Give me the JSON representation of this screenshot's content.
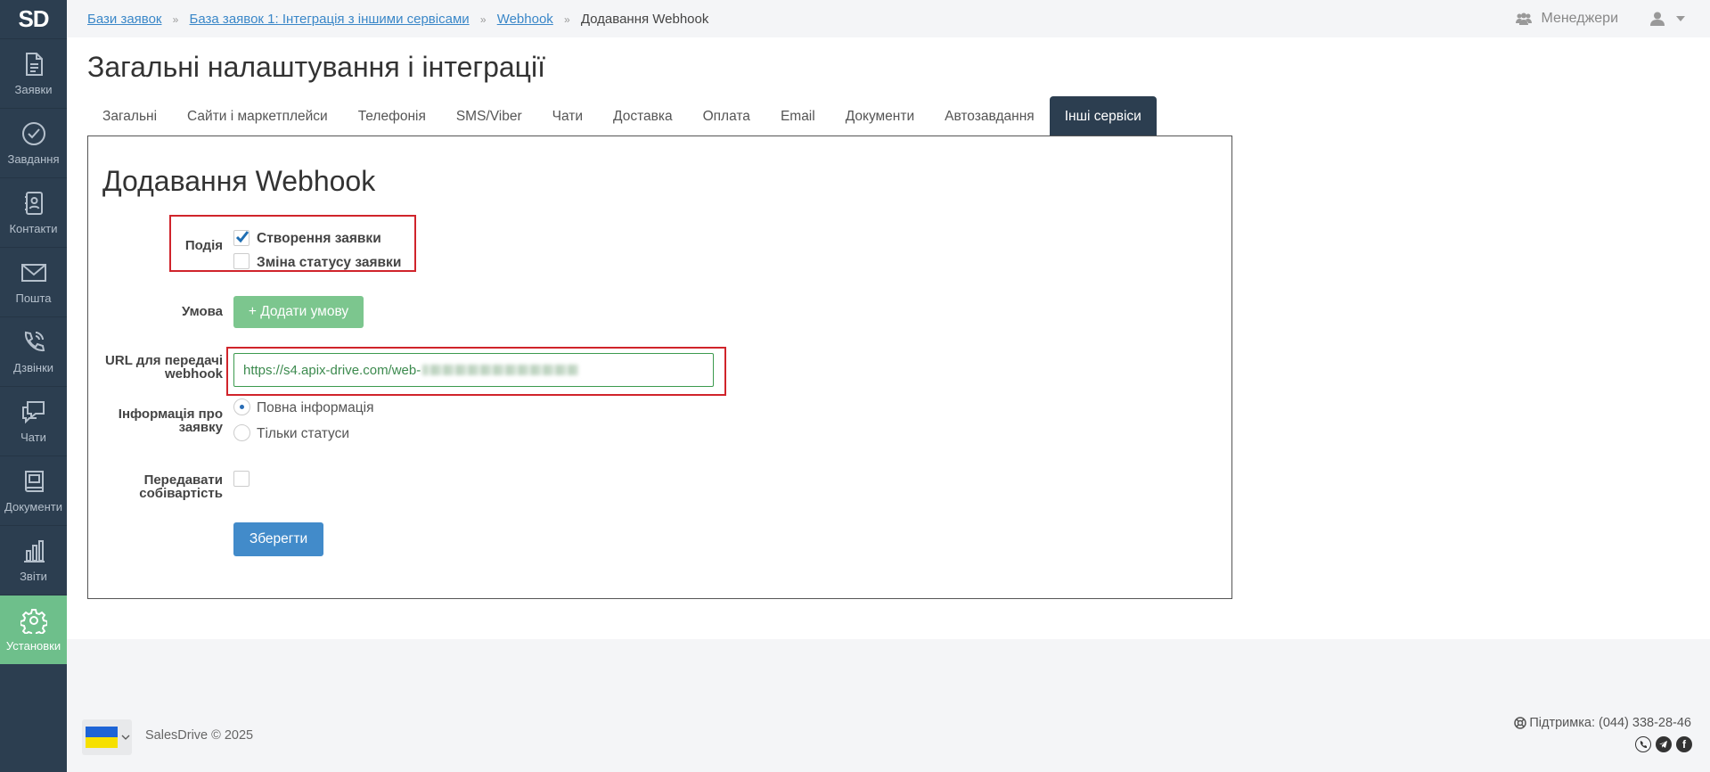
{
  "sidebar": {
    "logo": "SD",
    "items": [
      {
        "label": "Заявки",
        "icon": "document-icon"
      },
      {
        "label": "Завдання",
        "icon": "check-circle-icon"
      },
      {
        "label": "Контакти",
        "icon": "contacts-icon"
      },
      {
        "label": "Пошта",
        "icon": "mail-icon"
      },
      {
        "label": "Дзвінки",
        "icon": "phone-icon"
      },
      {
        "label": "Чати",
        "icon": "chat-icon"
      },
      {
        "label": "Документи",
        "icon": "book-icon"
      },
      {
        "label": "Звіти",
        "icon": "bar-chart-icon"
      },
      {
        "label": "Установки",
        "icon": "gear-icon",
        "active": true
      }
    ]
  },
  "breadcrumb": {
    "items": [
      "Бази заявок",
      "База заявок 1: Інтеграція з іншими сервісами",
      "Webhook"
    ],
    "separator": "»",
    "current": "Додавання Webhook"
  },
  "header": {
    "managers_label": "Менеджери",
    "user_icon": "user-icon"
  },
  "page": {
    "title": "Загальні налаштування і інтеграції"
  },
  "tabs": [
    {
      "label": "Загальні"
    },
    {
      "label": "Сайти і маркетплейси"
    },
    {
      "label": "Телефонія"
    },
    {
      "label": "SMS/Viber"
    },
    {
      "label": "Чати"
    },
    {
      "label": "Доставка"
    },
    {
      "label": "Оплата"
    },
    {
      "label": "Email"
    },
    {
      "label": "Документи"
    },
    {
      "label": "Автозавдання"
    },
    {
      "label": "Інші сервіси",
      "active": true
    }
  ],
  "form": {
    "title": "Додавання Webhook",
    "event_label": "Подія",
    "events": [
      {
        "label": "Створення заявки",
        "checked": true
      },
      {
        "label": "Зміна статусу заявки",
        "checked": false
      }
    ],
    "condition_label": "Умова",
    "add_condition_button": "+ Додати умову",
    "url_label_line1": "URL для передачі",
    "url_label_line2": "webhook",
    "url_value": "https://s4.apix-drive.com/web-",
    "info_label_line1": "Інформація про",
    "info_label_line2": "заявку",
    "info_options": [
      {
        "label": "Повна інформація",
        "selected": true
      },
      {
        "label": "Тільки статуси",
        "selected": false
      }
    ],
    "cost_label_line1": "Передавати",
    "cost_label_line2": "собівартість",
    "cost_checked": false,
    "save_button": "Зберегти"
  },
  "footer": {
    "copyright": "SalesDrive © 2025",
    "support": "Підтримка: (044) 338-28-46",
    "social": [
      "viber-icon",
      "telegram-icon",
      "facebook-icon"
    ],
    "colors": {
      "flag_blue": "#1e64d6",
      "flag_yellow": "#f6e000"
    }
  },
  "colors": {
    "sidebar_bg": "#2c3e50",
    "active_nav": "#6ebf8b",
    "link": "#3a87c8",
    "highlight_border": "#d0242b",
    "save_button": "#428bca",
    "add_button": "#7cc68e"
  }
}
